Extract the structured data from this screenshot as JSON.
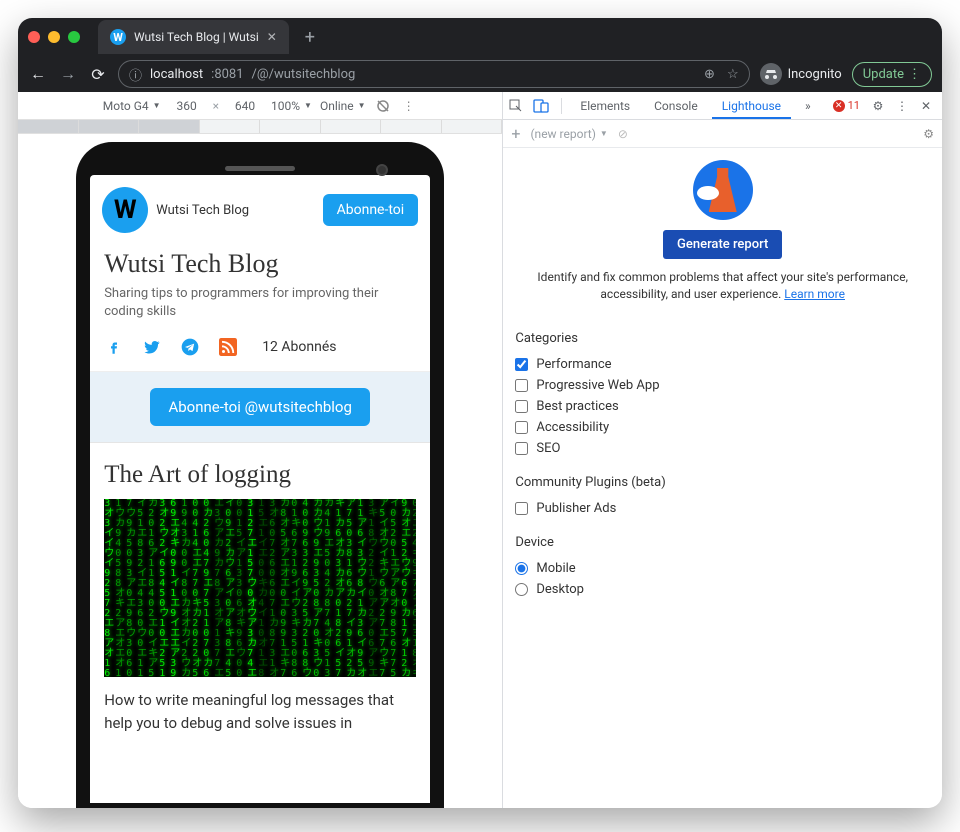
{
  "browser": {
    "tab_title": "Wutsi Tech Blog | Wutsi",
    "new_tab_plus": "+",
    "back": "←",
    "forward": "→",
    "reload": "⟳",
    "info_icon": "ⓘ",
    "url_host": "localhost",
    "url_port": ":8081",
    "url_path": "/@/wutsitechblog",
    "zoom_icon": "⊕",
    "star_icon": "☆",
    "incognito_label": "Incognito",
    "update_label": "Update",
    "menu_dots": "⋮"
  },
  "device_toolbar": {
    "device": "Moto G4",
    "width": "360",
    "height": "640",
    "zoom": "100%",
    "throttle": "Online"
  },
  "mobile": {
    "avatar_letter": "W",
    "site_name": "Wutsi Tech Blog",
    "subscribe": "Abonne-toi",
    "title": "Wutsi Tech Blog",
    "tagline": "Sharing tips to programmers for improving their coding skills",
    "followers": "12 Abonnés",
    "cta": "Abonne-toi @wutsitechblog",
    "article_title": "The Art of logging",
    "article_desc": "How to write meaningful log messages that help you to debug and solve issues in"
  },
  "devtools": {
    "tabs": {
      "elements": "Elements",
      "console": "Console",
      "lighthouse": "Lighthouse"
    },
    "chevrons": "»",
    "error_count": "11",
    "new_report": "(new report)",
    "generate": "Generate report",
    "desc_text": "Identify and fix common problems that affect your site's performance, accessibility, and user experience. ",
    "learn_more": "Learn more",
    "categories_heading": "Categories",
    "categories": [
      {
        "label": "Performance",
        "checked": true
      },
      {
        "label": "Progressive Web App",
        "checked": false
      },
      {
        "label": "Best practices",
        "checked": false
      },
      {
        "label": "Accessibility",
        "checked": false
      },
      {
        "label": "SEO",
        "checked": false
      }
    ],
    "plugins_heading": "Community Plugins (beta)",
    "plugins": [
      {
        "label": "Publisher Ads",
        "checked": false
      }
    ],
    "device_heading": "Device",
    "devices": [
      {
        "label": "Mobile",
        "checked": true
      },
      {
        "label": "Desktop",
        "checked": false
      }
    ]
  }
}
